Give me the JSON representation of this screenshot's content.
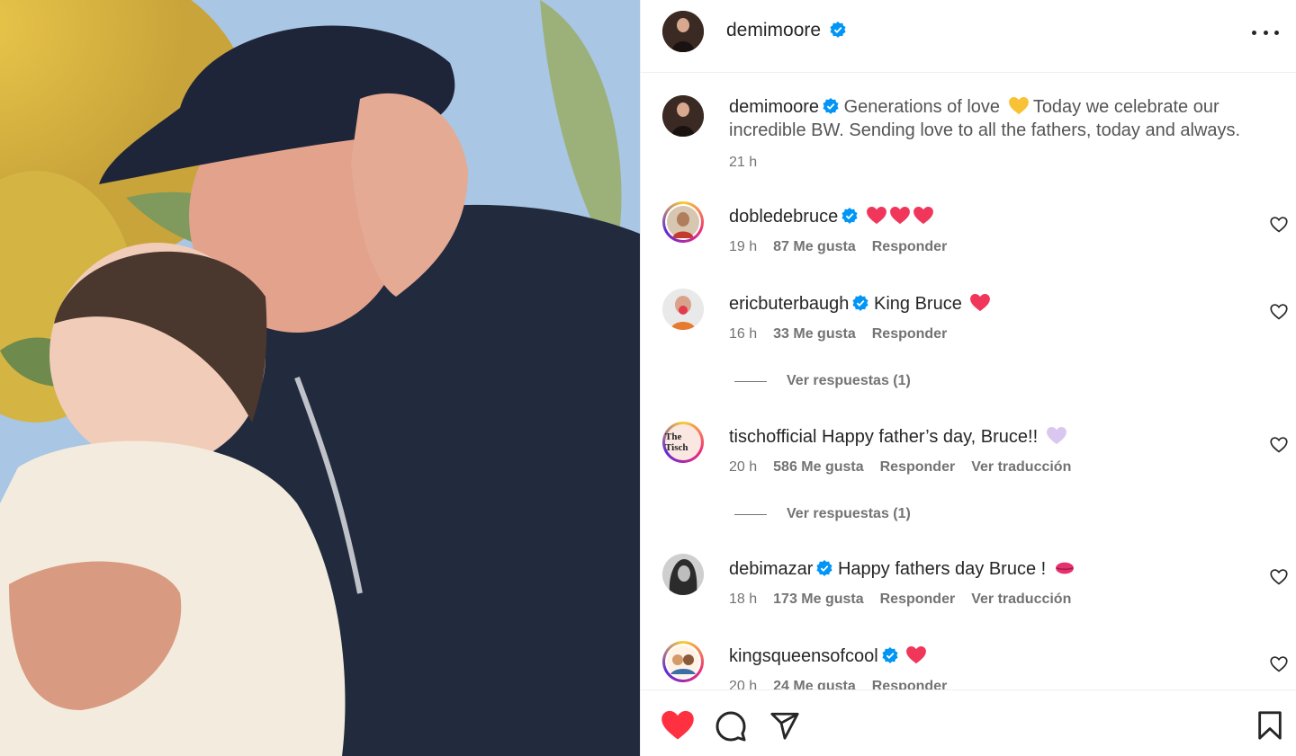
{
  "post": {
    "username": "demimoore",
    "caption": "Generations of love",
    "caption_rest": "Today we celebrate our incredible BW. Sending love to all the fathers, today and always.",
    "caption_time": "21 h"
  },
  "comments": [
    {
      "username": "dobledebruce",
      "text": "",
      "time": "19 h",
      "likes": "87 Me gusta",
      "reply": "Responder",
      "translate": ""
    },
    {
      "username": "ericbuterbaugh",
      "text": "King Bruce",
      "time": "16 h",
      "likes": "33 Me gusta",
      "reply": "Responder",
      "translate": "",
      "view_replies": "Ver respuestas (1)"
    },
    {
      "username": "tischofficial",
      "text": "Happy father’s day, Bruce!!",
      "time": "20 h",
      "likes": "586 Me gusta",
      "reply": "Responder",
      "translate": "Ver traducción",
      "view_replies": "Ver respuestas (1)",
      "avatar_text": "The Tisch"
    },
    {
      "username": "debimazar",
      "text": "Happy fathers day Bruce !",
      "time": "18 h",
      "likes": "173 Me gusta",
      "reply": "Responder",
      "translate": "Ver traducción"
    },
    {
      "username": "kingsqueensofcool",
      "text": "",
      "time": "20 h",
      "likes": "24 Me gusta",
      "reply": "Responder",
      "translate": ""
    }
  ],
  "colors": {
    "heart_red": "#ff3040",
    "verified_blue": "#0095f6",
    "meta_gray": "#737373",
    "border": "#efefef"
  },
  "icons": [
    "more-options-icon",
    "verified-badge-icon",
    "heart-icon",
    "comment-icon",
    "share-icon",
    "bookmark-icon"
  ]
}
